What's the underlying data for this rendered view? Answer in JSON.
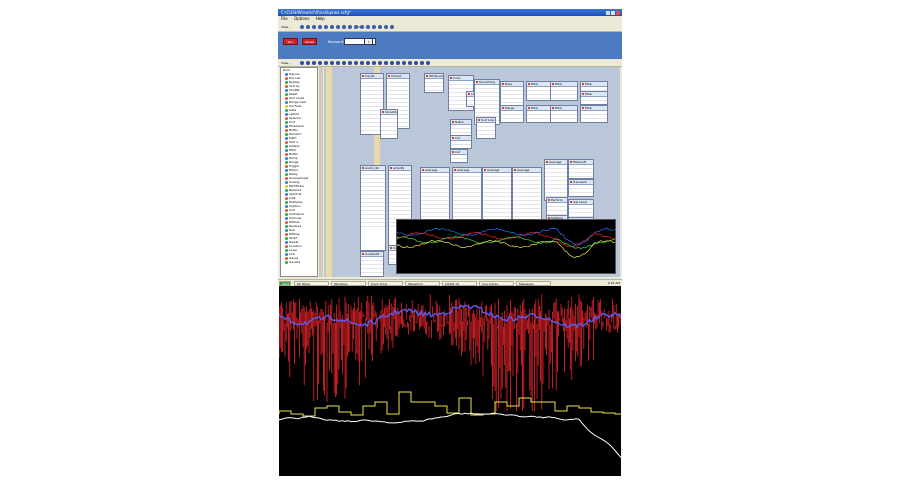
{
  "window": {
    "title": "C:\\CUSHW\\switch\\final\\kprwa.scfg*",
    "menu": [
      "File",
      "Options",
      "Help"
    ]
  },
  "toolbar": {
    "view_label": "View...",
    "preset_label": "5 Pr...",
    "run_label": "Run",
    "cancel_label": "Pause"
  },
  "keyword_panel": {
    "label": "Keyword:",
    "value": "",
    "button_label": "?"
  },
  "sidebar": {
    "root_label": "Root",
    "items": [
      {
        "label": "Figures",
        "color": "#2c7bd6"
      },
      {
        "label": "Pos sub",
        "color": "#d6572c"
      },
      {
        "label": "Bypass",
        "color": "#33a34a"
      },
      {
        "label": "Sort by",
        "color": "#d6572c"
      },
      {
        "label": "Shuffle",
        "color": "#2c7bd6"
      },
      {
        "label": "Reset",
        "color": "#33a34a"
      },
      {
        "label": "Grid Level",
        "color": "#d6572c"
      },
      {
        "label": "Range Gain",
        "color": "#2c7bd6"
      },
      {
        "label": "Vol Fade",
        "color": "#d6c82c"
      },
      {
        "label": "Gate",
        "color": "#33a34a"
      },
      {
        "label": "Lattice",
        "color": "#2c7bd6"
      },
      {
        "label": "Selector",
        "color": "#d6572c"
      },
      {
        "label": "Sort",
        "color": "#33a34a"
      },
      {
        "label": "Filterbank",
        "color": "#2c7bd6"
      },
      {
        "label": "Buffer",
        "color": "#d6572c"
      },
      {
        "label": "Random",
        "color": "#33a34a"
      },
      {
        "label": "Math",
        "color": "#2c7bd6"
      },
      {
        "label": "Mod 1",
        "color": "#d6572c"
      },
      {
        "label": "Adders",
        "color": "#33a34a"
      },
      {
        "label": "Filter",
        "color": "#2c7bd6"
      },
      {
        "label": "Buffer",
        "color": "#d6572c"
      },
      {
        "label": "Ramp",
        "color": "#2c7bd6"
      },
      {
        "label": "Range",
        "color": "#33a34a"
      },
      {
        "label": "Trigger",
        "color": "#d6572c"
      },
      {
        "label": "Filters",
        "color": "#2c7bd6"
      },
      {
        "label": "Delay",
        "color": "#33a34a"
      },
      {
        "label": "Downsample",
        "color": "#d6572c"
      },
      {
        "label": "Analog",
        "color": "#2c7bd6"
      },
      {
        "label": "Pathfinder",
        "color": "#d6c82c"
      },
      {
        "label": "Network",
        "color": "#33a34a"
      },
      {
        "label": "Spectral",
        "color": "#2c7bd6"
      },
      {
        "label": "pilot",
        "color": "#d6572c"
      },
      {
        "label": "Multiplex",
        "color": "#33a34a"
      },
      {
        "label": "Caption",
        "color": "#2c7bd6"
      },
      {
        "label": "Unit",
        "color": "#d6572c"
      },
      {
        "label": "Ambience",
        "color": "#33a34a"
      },
      {
        "label": "Channel",
        "color": "#2c7bd6"
      },
      {
        "label": "Pitches",
        "color": "#d6572c"
      },
      {
        "label": "Reverse",
        "color": "#33a34a"
      },
      {
        "label": "Dial",
        "color": "#2c7bd6"
      },
      {
        "label": "Diffuse",
        "color": "#d6572c"
      },
      {
        "label": "Strait",
        "color": "#33a34a"
      },
      {
        "label": "Ripple",
        "color": "#2c7bd6"
      },
      {
        "label": "Location",
        "color": "#d6572c"
      },
      {
        "label": "Level",
        "color": "#33a34a"
      },
      {
        "label": "Link",
        "color": "#2c7bd6"
      },
      {
        "label": "Gauss",
        "color": "#d6572c"
      },
      {
        "label": "Gaussq",
        "color": "#33a34a"
      }
    ]
  },
  "modules": [
    {
      "name": "Inputs",
      "rows": 16
    },
    {
      "name": "Output",
      "rows": 14
    },
    {
      "name": "Whitenoise",
      "rows": 4
    },
    {
      "name": "Conv",
      "rows": 8
    },
    {
      "name": "Lead",
      "rows": 4
    },
    {
      "name": "SmoothDelay",
      "rows": 8
    },
    {
      "name": "Smoothing",
      "rows": 12
    },
    {
      "name": "Sort Low",
      "rows": 5
    },
    {
      "name": "N-Bus",
      "rows": 6
    },
    {
      "name": "Cut",
      "rows": 3
    },
    {
      "name": "Cut",
      "rows": 3
    },
    {
      "name": "Bass",
      "rows": 4
    },
    {
      "name": "Filter",
      "rows": 4
    },
    {
      "name": "Filter",
      "rows": 4
    },
    {
      "name": "Filter",
      "rows": 4
    },
    {
      "name": "Merge",
      "rows": 4
    },
    {
      "name": "Filter",
      "rows": 4
    },
    {
      "name": "Filter",
      "rows": 4
    },
    {
      "name": "Filter",
      "rows": 4
    },
    {
      "name": "Filter",
      "rows": 4
    },
    {
      "name": "Audio_4b",
      "rows": 14
    },
    {
      "name": "Amplify",
      "rows": 14
    },
    {
      "name": "Average",
      "rows": 16
    },
    {
      "name": "Average",
      "rows": 16
    },
    {
      "name": "Average",
      "rows": 16
    },
    {
      "name": "Average",
      "rows": 16
    },
    {
      "name": "Average",
      "rows": 16
    },
    {
      "name": "FilterLeft",
      "rows": 8
    },
    {
      "name": "Transient",
      "rows": 3
    },
    {
      "name": "Gal Level",
      "rows": 3
    },
    {
      "name": "Rating",
      "rows": 3
    },
    {
      "name": "Perform",
      "rows": 5
    },
    {
      "name": "Multiple",
      "rows": 5
    },
    {
      "name": "AudioLeft",
      "rows": 6
    },
    {
      "name": "Cut",
      "rows": 3
    }
  ],
  "taskbar": {
    "start_label": "Start",
    "tasks": [
      "PC Mixer",
      "Patchbay",
      "Track Time",
      "Waveform",
      "CUSW 14",
      "Cue points",
      "Messages"
    ],
    "clock": "9:15 AM"
  },
  "colors": {
    "scope_bg": "#000000",
    "scope_red": "#e8242a",
    "scope_blue": "#5a5cf0",
    "scope_yellow": "#f0e24a",
    "scope_white": "#ffffff"
  }
}
